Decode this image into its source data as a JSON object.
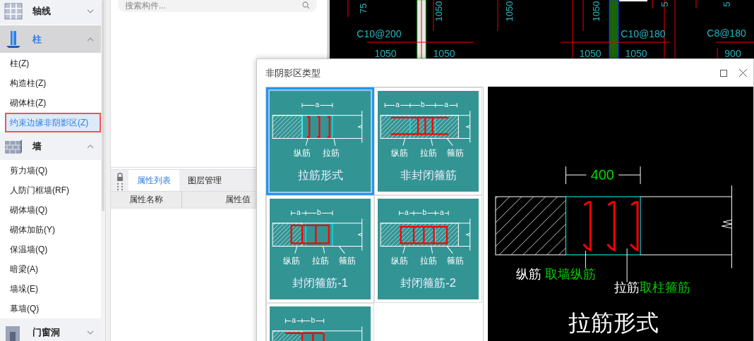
{
  "sidebar": {
    "groups": [
      {
        "label": "轴线",
        "kind": "grid",
        "expanded": false,
        "selected": false
      },
      {
        "label": "柱",
        "kind": "column",
        "expanded": true,
        "selected": true,
        "items": [
          {
            "label": "柱(Z)",
            "selected": false
          },
          {
            "label": "构造柱(Z)",
            "selected": false
          },
          {
            "label": "砌体柱(Z)",
            "selected": false
          },
          {
            "label": "约束边缘非阴影区(Z)",
            "selected": true
          }
        ]
      },
      {
        "label": "墙",
        "kind": "wall",
        "expanded": true,
        "selected": false,
        "items": [
          {
            "label": "剪力墙(Q)",
            "selected": false
          },
          {
            "label": "人防门框墙(RF)",
            "selected": false
          },
          {
            "label": "砌体墙(Q)",
            "selected": false
          },
          {
            "label": "砌体加筋(Y)",
            "selected": false
          },
          {
            "label": "保温墙(Q)",
            "selected": false
          },
          {
            "label": "暗梁(A)",
            "selected": false
          },
          {
            "label": "墙垛(E)",
            "selected": false
          },
          {
            "label": "幕墙(Q)",
            "selected": false
          }
        ]
      },
      {
        "label": "门窗洞",
        "kind": "door",
        "expanded": false,
        "selected": false
      }
    ]
  },
  "component_panel": {
    "search": {
      "placeholder": "搜索构件..."
    }
  },
  "property_panel": {
    "tabs": [
      {
        "label": "属性列表",
        "selected": true
      },
      {
        "label": "图层管理",
        "selected": false
      }
    ],
    "columns": [
      "属性名称",
      "属性值"
    ]
  },
  "drawing": {
    "labels": [
      {
        "text": "75",
        "kind": "vertical"
      },
      {
        "text": "1050",
        "kind": "vertical"
      },
      {
        "text": "1050",
        "kind": "vertical"
      },
      {
        "text": "1050",
        "kind": "vertical"
      },
      {
        "text": "5",
        "kind": "vertical"
      },
      {
        "text": "5",
        "kind": "vertical"
      },
      {
        "text": "C10@200",
        "kind": "horizontal"
      },
      {
        "text": "C10@180",
        "kind": "horizontal"
      },
      {
        "text": "C8@180",
        "kind": "horizontal"
      },
      {
        "text": "1050",
        "kind": "horizontal"
      },
      {
        "text": "1050",
        "kind": "horizontal"
      },
      {
        "text": "1050",
        "kind": "horizontal"
      },
      {
        "text": "1050",
        "kind": "horizontal"
      },
      {
        "text": "900",
        "kind": "horizontal"
      }
    ]
  },
  "dialog": {
    "title": "非阴影区类型",
    "options": [
      {
        "kind": "tie",
        "selected": true,
        "dims": [
          "a"
        ],
        "labels": [
          "纵筋",
          "拉筋"
        ],
        "title": "拉筋形式"
      },
      {
        "kind": "open-stirrup",
        "selected": false,
        "dims": [
          "a",
          "b",
          "a"
        ],
        "labels": [
          "纵筋",
          "拉筋",
          "箍筋"
        ],
        "title": "非封闭箍筋"
      },
      {
        "kind": "closed-1",
        "selected": false,
        "dims": [
          "a",
          "b"
        ],
        "labels": [
          "纵筋",
          "拉筋",
          "箍筋"
        ],
        "title": "封闭箍筋-1"
      },
      {
        "kind": "closed-2",
        "selected": false,
        "dims": [
          "a",
          "b",
          "a"
        ],
        "labels": [
          "纵筋",
          "拉筋",
          "箍筋"
        ],
        "title": "封闭箍筋-2"
      },
      {
        "kind": "closed-3",
        "selected": false,
        "dims": [
          "a",
          "b"
        ]
      }
    ],
    "preview": {
      "dimension": "400",
      "notes": [
        {
          "label": "纵筋",
          "value": "取墙纵筋"
        },
        {
          "label": "拉筋",
          "value": "取柱箍筋"
        }
      ],
      "title": "拉筋形式"
    }
  }
}
